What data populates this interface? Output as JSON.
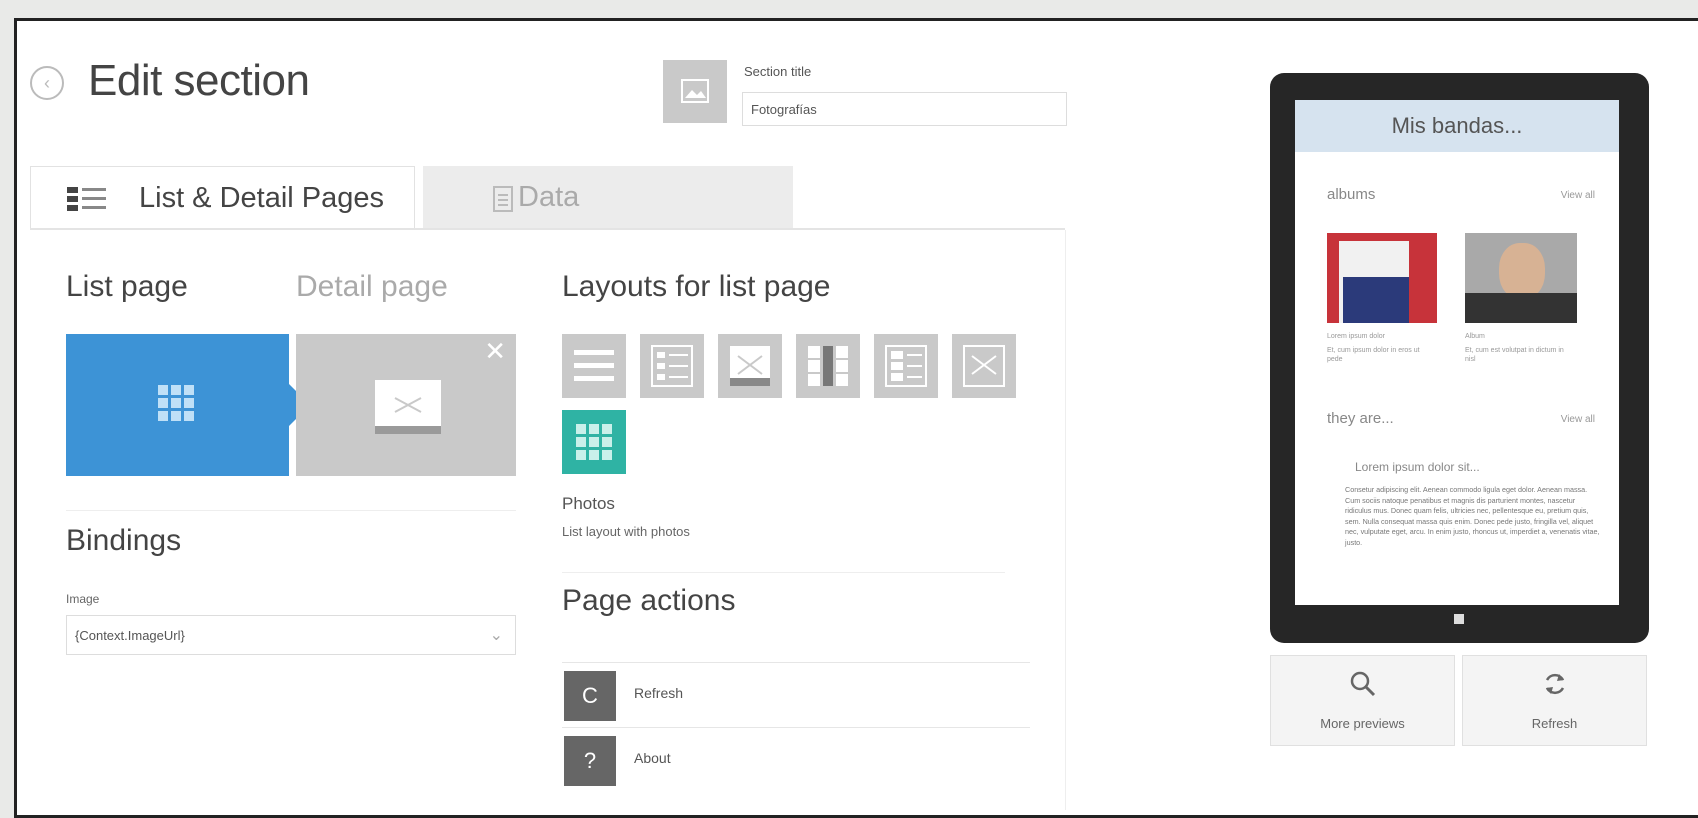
{
  "header": {
    "title": "Edit section",
    "back_icon": "back-arrow-icon",
    "section_title_label": "Section title",
    "section_title_value": "Fotografías"
  },
  "tabs": [
    {
      "label": "List & Detail Pages",
      "icon": "list-pages-icon",
      "active": true
    },
    {
      "label": "Data",
      "icon": "document-icon",
      "active": false
    }
  ],
  "pages": {
    "list_label": "List page",
    "detail_label": "Detail page"
  },
  "bindings": {
    "title": "Bindings",
    "image_label": "Image",
    "image_value": "{Context.ImageUrl}"
  },
  "layouts": {
    "title": "Layouts for list page",
    "selected_name": "Photos",
    "selected_desc": "List layout with photos",
    "items": [
      "list",
      "list-detail",
      "image",
      "tile-list",
      "tile-list-2",
      "image-2",
      "photos"
    ]
  },
  "actions": {
    "title": "Page actions",
    "items": [
      {
        "label": "Refresh",
        "icon": "refresh-icon",
        "glyph": "C"
      },
      {
        "label": "About",
        "icon": "help-icon",
        "glyph": "?"
      }
    ]
  },
  "preview": {
    "app_title": "Mis bandas...",
    "section1": "albums",
    "section2": "they are...",
    "view_all": "View all",
    "cap1_title": "Lorem ipsum dolor",
    "cap1_text": "Et, cum ipsum dolor in eros ut pede",
    "cap2_title": "Album",
    "cap2_text": "Et, cum est volutpat in dictum in nisl",
    "lorem_title": "Lorem ipsum dolor sit...",
    "lorem_text": "Consetur adipiscing elit. Aenean commodo ligula eget dolor. Aenean massa. Cum sociis natoque penatibus et magnis dis parturient montes, nascetur ridiculus mus. Donec quam felis, ultricies nec, pellentesque eu, pretium quis, sem. Nulla consequat massa quis enim. Donec pede justo, fringilla vel, aliquet nec, vulputate eget, arcu. In enim justo, rhoncus ut, imperdiet a, venenatis vitae, justo.",
    "buttons": [
      {
        "label": "More previews",
        "icon": "search-icon"
      },
      {
        "label": "Refresh",
        "icon": "refresh-icon"
      }
    ]
  },
  "colors": {
    "accent_blue": "#3d93d6",
    "selected_teal": "#2fb3a4"
  }
}
